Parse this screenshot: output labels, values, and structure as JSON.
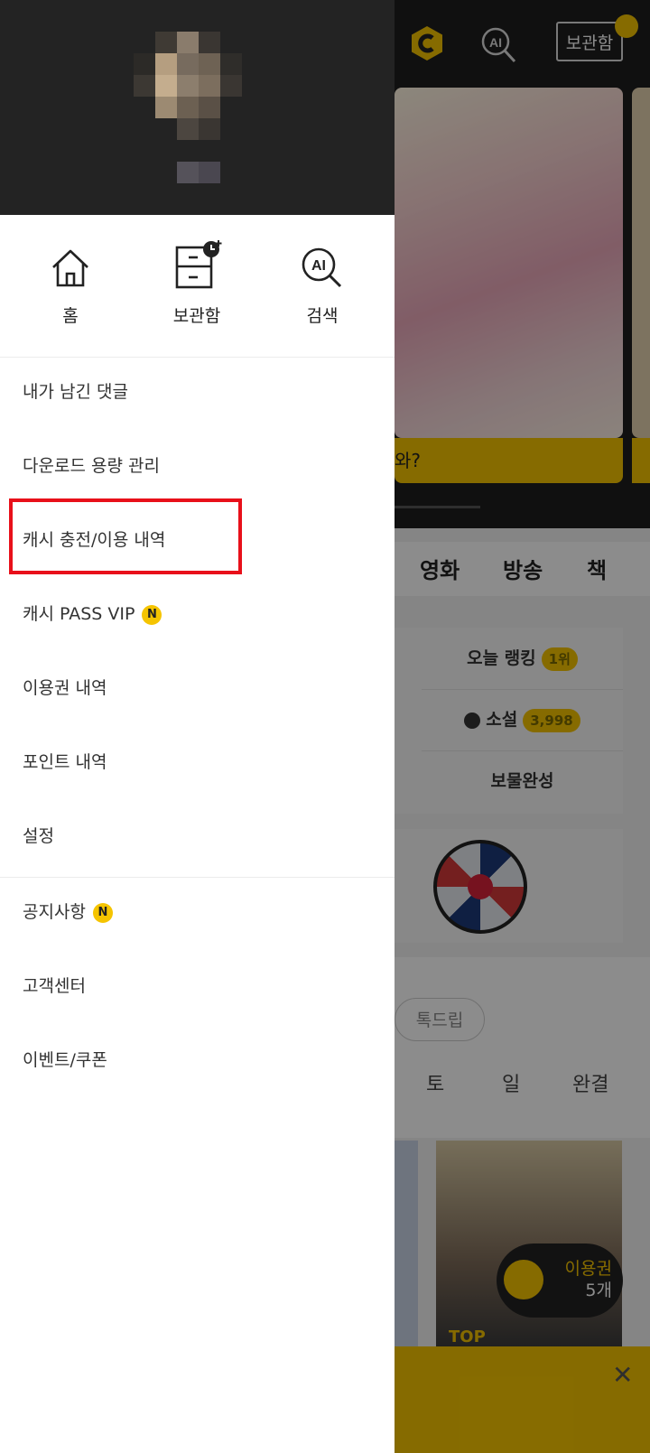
{
  "background": {
    "header": {
      "locker_label": "보관함"
    },
    "hero": {
      "caption": "와?"
    },
    "category_tabs": [
      "영화",
      "방송",
      "책"
    ],
    "ranking": {
      "today_label": "오늘 랭킹",
      "today_badge": "1위",
      "novel_label": "소설",
      "novel_badge": "3,998",
      "treasure_label": "보물완성"
    },
    "filter_chip": "톡드립",
    "weekdays": [
      "토",
      "일",
      "완결"
    ],
    "thumb_label": "TOP",
    "pass_float": {
      "line1": "이용권",
      "line2": "5개"
    }
  },
  "drawer": {
    "quick_actions": [
      {
        "label": "홈",
        "icon": "home-icon"
      },
      {
        "label": "보관함",
        "icon": "locker-icon"
      },
      {
        "label": "검색",
        "icon": "ai-search-icon"
      }
    ],
    "menu": [
      {
        "label": "내가 남긴 댓글",
        "new": false
      },
      {
        "label": "다운로드 용량 관리",
        "new": false
      },
      {
        "label": "캐시 충전/이용 내역",
        "new": false,
        "highlighted": true
      },
      {
        "label": "캐시 PASS VIP",
        "new": true
      },
      {
        "label": "이용권 내역",
        "new": false
      },
      {
        "label": "포인트 내역",
        "new": false
      },
      {
        "label": "설정",
        "new": false
      }
    ],
    "menu2": [
      {
        "label": "공지사항",
        "new": true
      },
      {
        "label": "고객센터",
        "new": false
      },
      {
        "label": "이벤트/쿠폰",
        "new": false
      }
    ],
    "new_badge_label": "N"
  },
  "colors": {
    "accent": "#f5c400",
    "highlight_border": "#e8101a",
    "drawer_header": "#232323"
  }
}
